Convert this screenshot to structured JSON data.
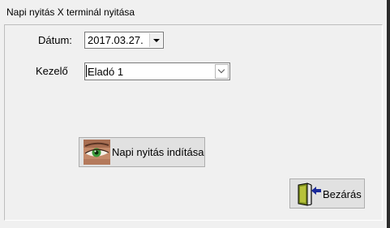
{
  "window": {
    "title": "Napi nyitás X terminál nyitása"
  },
  "form": {
    "date_label": "Dátum:",
    "date_value": "2017.03.27.",
    "operator_label": "Kezelő",
    "operator_value": "Eladó 1"
  },
  "buttons": {
    "start_label": "Napi nyitás indítása",
    "start_icon": "eye-icon",
    "close_label": "Bezárás",
    "close_icon": "exit-door-icon"
  },
  "colors": {
    "window_bg": "#f0f0f0",
    "button_bg": "#e1e1e1",
    "border": "#adadad",
    "door_green": "#7a8a1e",
    "arrow_blue": "#1b2a9a"
  }
}
